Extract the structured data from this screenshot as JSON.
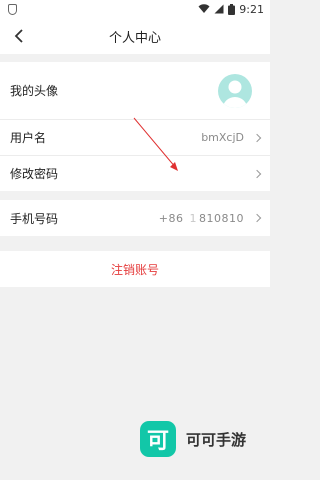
{
  "status_bar": {
    "time": "9:21",
    "icons": [
      "shield-icon",
      "wifi-icon",
      "cellular-signal-icon",
      "battery-icon"
    ]
  },
  "nav": {
    "title": "个人中心",
    "back_icon": "chevron-left-icon"
  },
  "profile": {
    "avatar_label": "我的头像",
    "username_label": "用户名",
    "username_value": "bmXcjD",
    "password_label": "修改密码"
  },
  "account": {
    "phone_label": "手机号码",
    "phone_prefix": "+86",
    "phone_masked": "1 ",
    "phone_value": "810810"
  },
  "logout": {
    "label": "注销账号"
  },
  "watermark": {
    "logo_char": "可",
    "text": "可可手游"
  },
  "colors": {
    "accent_teal": "#12c7a8",
    "avatar_bg": "#aee6e0",
    "danger_red": "#e53b3b",
    "background": "#f1f1f1"
  }
}
